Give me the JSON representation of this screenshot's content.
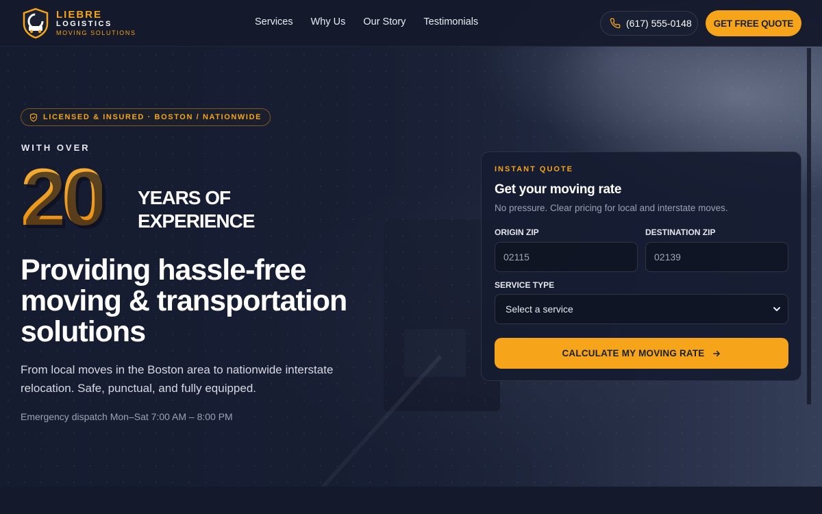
{
  "brand": {
    "name": "LIEBRE",
    "sub": "LOGISTICS",
    "tagline": "MOVING SOLUTIONS"
  },
  "nav": {
    "items": [
      "Services",
      "Why Us",
      "Our Story",
      "Testimonials"
    ]
  },
  "header": {
    "phone": "(617) 555-0148",
    "cta": "GET FREE QUOTE"
  },
  "hero": {
    "badge": "LICENSED & INSURED · BOSTON / NATIONWIDE",
    "with_over": "WITH OVER",
    "years_number": "20",
    "years_line1": "YEARS OF",
    "years_line2": "EXPERIENCE",
    "headline": "Providing hassle-free moving & transportation solutions",
    "subtext": "From local moves in the Boston area to nationwide interstate relocation. Safe, punctual, and fully equipped.",
    "hours": "Emergency dispatch Mon–Sat 7:00 AM – 8:00 PM"
  },
  "quote": {
    "eyebrow": "INSTANT QUOTE",
    "title": "Get your moving rate",
    "description": "No pressure. Clear pricing for local and interstate moves.",
    "origin_label": "ORIGIN ZIP",
    "origin_placeholder": "02115",
    "destination_label": "DESTINATION ZIP",
    "destination_placeholder": "02139",
    "service_label": "SERVICE TYPE",
    "service_value": "Select a service",
    "submit": "CALCULATE MY MOVING RATE"
  },
  "colors": {
    "accent": "#f6a51a",
    "background": "#141a2c"
  },
  "icons": {
    "logo": "shield-truck-icon",
    "phone": "phone-icon",
    "badge": "shield-check-icon",
    "select": "chevron-down-icon",
    "submit": "arrow-right-icon"
  }
}
